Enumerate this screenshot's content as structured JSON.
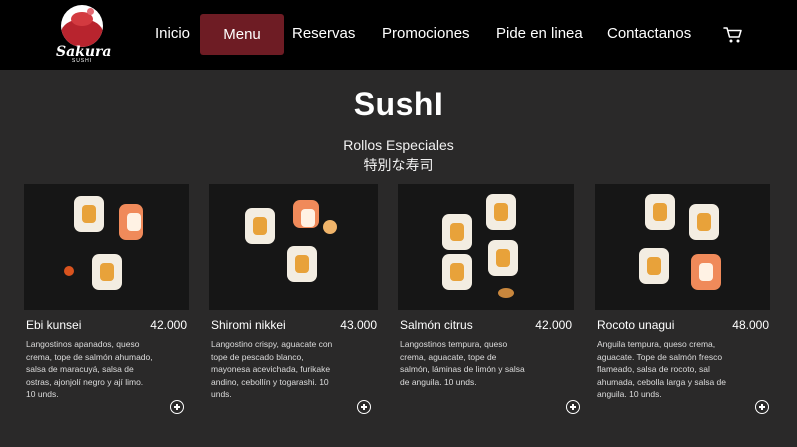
{
  "brand": {
    "name": "Sakura",
    "tagline": "SUSHI"
  },
  "nav": {
    "items": [
      {
        "label": "Inicio"
      },
      {
        "label": "Menu"
      },
      {
        "label": "Reservas"
      },
      {
        "label": "Promociones"
      },
      {
        "label": "Pide en linea"
      },
      {
        "label": "Contactanos"
      }
    ],
    "active": "Menu",
    "cart_icon": "cart-icon"
  },
  "page": {
    "title": "SushI",
    "section": "Rollos Especiales",
    "section_jp": "特別な寿司"
  },
  "products": [
    {
      "name": "Ebi kunsei",
      "price": "42.000",
      "description": "Langostinos apanados, queso crema, tope de salmón ahumado, salsa de maracuyá, salsa de ostras, ajonjolí negro y ají limo. 10 unds."
    },
    {
      "name": "Shiromi nikkei",
      "price": "43.000",
      "description": "Langostino crispy, aguacate con tope de pescado blanco, mayonesa acevichada, furikake andino, cebollín y togarashi. 10 unds."
    },
    {
      "name": "Salmón citrus",
      "price": "42.000",
      "description": "Langostinos tempura, queso crema, aguacate, tope de salmón, láminas de limón y salsa de anguila. 10 unds."
    },
    {
      "name": "Rocoto unagui",
      "price": "48.000",
      "description": "Anguila tempura, queso crema, aguacate. Tope de salmón fresco flameado, salsa de rocoto, sal ahumada, cebolla larga y salsa de anguila. 10 unds."
    }
  ],
  "colors": {
    "nav_bg": "#000000",
    "active_bg": "#6e1c24",
    "page_bg": "#2a2929"
  }
}
